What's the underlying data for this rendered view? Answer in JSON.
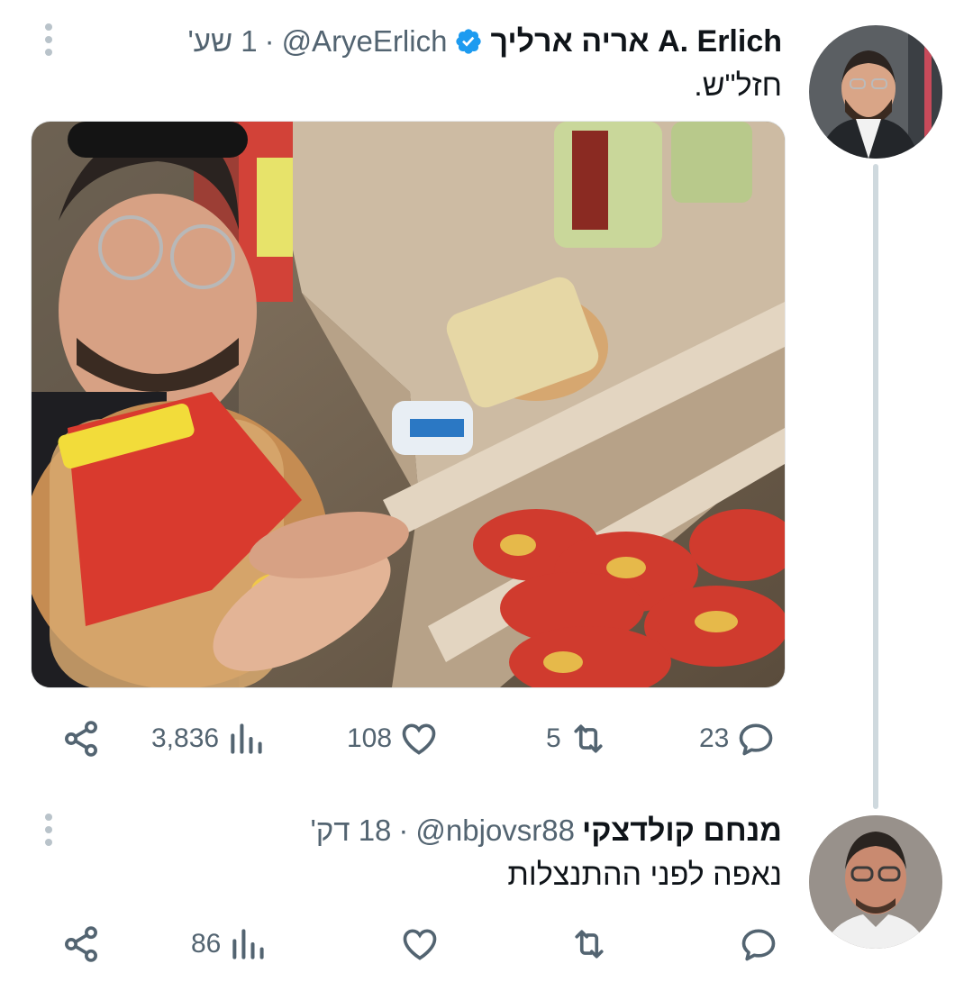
{
  "tweet": {
    "name": "אריה ארליך A. Erlich",
    "handle": "@AryeErlich",
    "separator": "·",
    "time": "1 שע'",
    "text": "חזל\"ש.",
    "stats": {
      "views": "3,836",
      "likes": "108",
      "retweets": "5",
      "replies": "23"
    }
  },
  "reply": {
    "name": "מנחם קולדצקי",
    "handle": "@nbjovsr88",
    "separator": "·",
    "time": "18 דק'",
    "text": "נאפה לפני ההתנצלות",
    "stats": {
      "views": "86"
    }
  },
  "colors": {
    "verified": "#1d9bf0",
    "muted": "#536471",
    "thread_line": "#cfd9de"
  },
  "icons": [
    "more-icon",
    "verified-icon",
    "share-icon",
    "views-icon",
    "like-icon",
    "retweet-icon",
    "reply-icon"
  ]
}
